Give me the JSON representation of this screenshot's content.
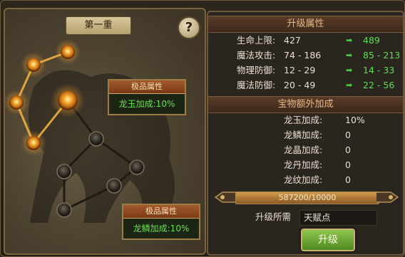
{
  "left_panel": {
    "title": "第一重",
    "help_symbol": "?",
    "attr_box_top": {
      "header": "极品属性",
      "value": "龙玉加成:10%"
    },
    "attr_box_bottom": {
      "header": "极品属性",
      "value": "龙鳞加成:10%"
    },
    "lit_node_count": 5,
    "total_node_count": 10
  },
  "right_panel": {
    "upgrade_header": "升级属性",
    "stats": [
      {
        "label": "生命上限:",
        "current": "427",
        "next": "489"
      },
      {
        "label": "魔法攻击:",
        "current": "74 - 186",
        "next": "85 - 213"
      },
      {
        "label": "物理防御:",
        "current": "12 - 29",
        "next": "14 - 33"
      },
      {
        "label": "魔法防御:",
        "current": "20 - 49",
        "next": "22 - 56"
      }
    ],
    "bonus_header": "宝物额外加成",
    "bonuses": [
      {
        "label": "龙玉加成:",
        "value": "10%"
      },
      {
        "label": "龙鳞加成:",
        "value": "0"
      },
      {
        "label": "龙晶加成:",
        "value": "0"
      },
      {
        "label": "龙丹加成:",
        "value": "0"
      },
      {
        "label": "龙纹加成:",
        "value": "0"
      }
    ],
    "progress_text": "587200/10000",
    "progress_fill": 1.0,
    "requirement_label": "升级所需",
    "requirement_value": "天赋点",
    "upgrade_button": "升级",
    "arrow_icon": "green-right-arrow-icon"
  },
  "colors": {
    "next_value_green": "#5be04a",
    "text_light": "#e8e0cf",
    "header_orange": "#e6b88a",
    "glow_orange": "#f0a030"
  }
}
